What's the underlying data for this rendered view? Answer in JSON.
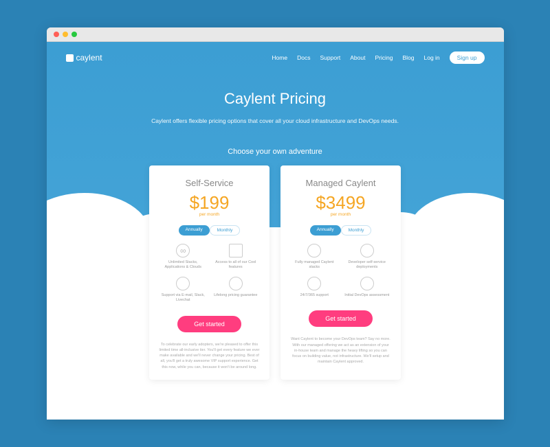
{
  "logo": "caylent",
  "nav": {
    "home": "Home",
    "docs": "Docs",
    "support": "Support",
    "about": "About",
    "pricing": "Pricing",
    "blog": "Blog",
    "login": "Log in",
    "signup": "Sign up"
  },
  "hero": {
    "title": "Caylent Pricing",
    "subtitle": "Caylent offers flexible pricing options that cover all your cloud infrastructure and DevOps needs."
  },
  "adventure": "Choose your own adventure",
  "plans": [
    {
      "name": "Self-Service",
      "price": "$199",
      "period": "per month",
      "toggle_active": "Annually",
      "toggle_inactive": "Monthly",
      "features": [
        "Unlimited Stacks, Applications & Clouds",
        "Access to all of our Cool features",
        "Support via E-mail, Slack, Livechat",
        "Lifelong pricing guarantee"
      ],
      "cta": "Get started",
      "desc": "To celebrate our early adopters, we're pleased to offer this limited time all-inclusive tier. You'll get every feature we ever make available and we'll never change your pricing. Best of all, you'll get a truly awesome VIP support experience. Get this now, while you can, because it won't be around long."
    },
    {
      "name": "Managed Caylent",
      "price": "$3499",
      "period": "per month",
      "toggle_active": "Annually",
      "toggle_inactive": "Monthly",
      "features": [
        "Fully managed Caylent stacks",
        "Developer self-service deployments",
        "24/7/365 support",
        "Initial DevOps assessment"
      ],
      "cta": "Get started",
      "desc": "Want Caylent to become your DevOps team? Say no more. With our managed offering we act as an extension of your in-house team and manage the heavy lifting so you can focus on building value, not infrastructure. We'll setup and maintain Caylent approved."
    }
  ]
}
